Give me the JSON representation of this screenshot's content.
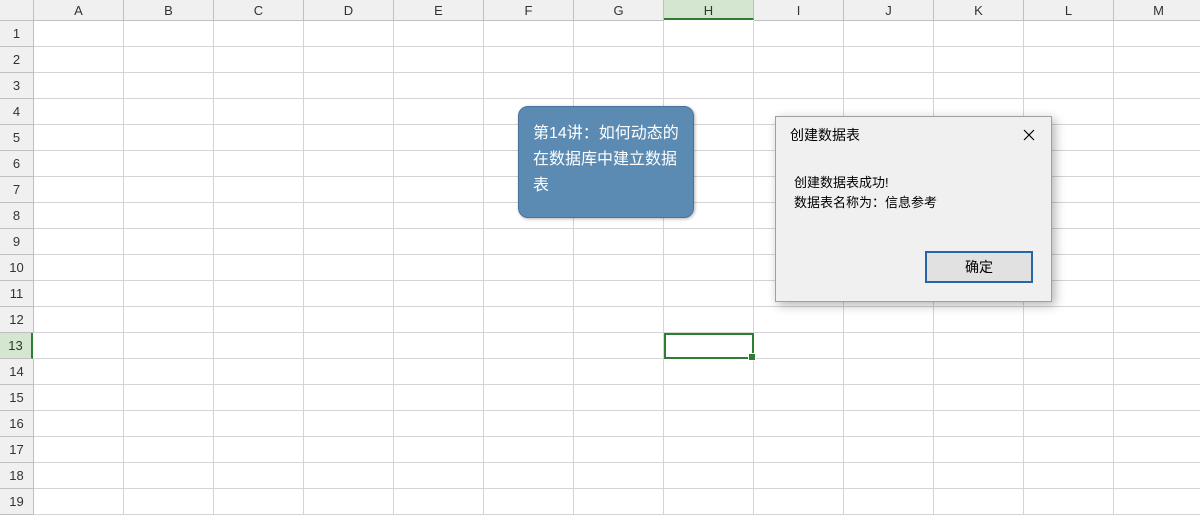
{
  "columns": [
    "A",
    "B",
    "C",
    "D",
    "E",
    "F",
    "G",
    "H",
    "I",
    "J",
    "K",
    "L",
    "M"
  ],
  "rows": [
    "1",
    "2",
    "3",
    "4",
    "5",
    "6",
    "7",
    "8",
    "9",
    "10",
    "11",
    "12",
    "13",
    "14",
    "15",
    "16",
    "17",
    "18",
    "19"
  ],
  "active_cell": {
    "row_index": 12,
    "col_index": 7
  },
  "selected_col_index": 7,
  "selected_row_index": 12,
  "callout": {
    "text": "第14讲：如何动态的在数据库中建立数据表"
  },
  "dialog": {
    "title": "创建数据表",
    "message_line1": "创建数据表成功!",
    "message_line2": "数据表名称为：信息参考",
    "ok_label": "确定"
  }
}
